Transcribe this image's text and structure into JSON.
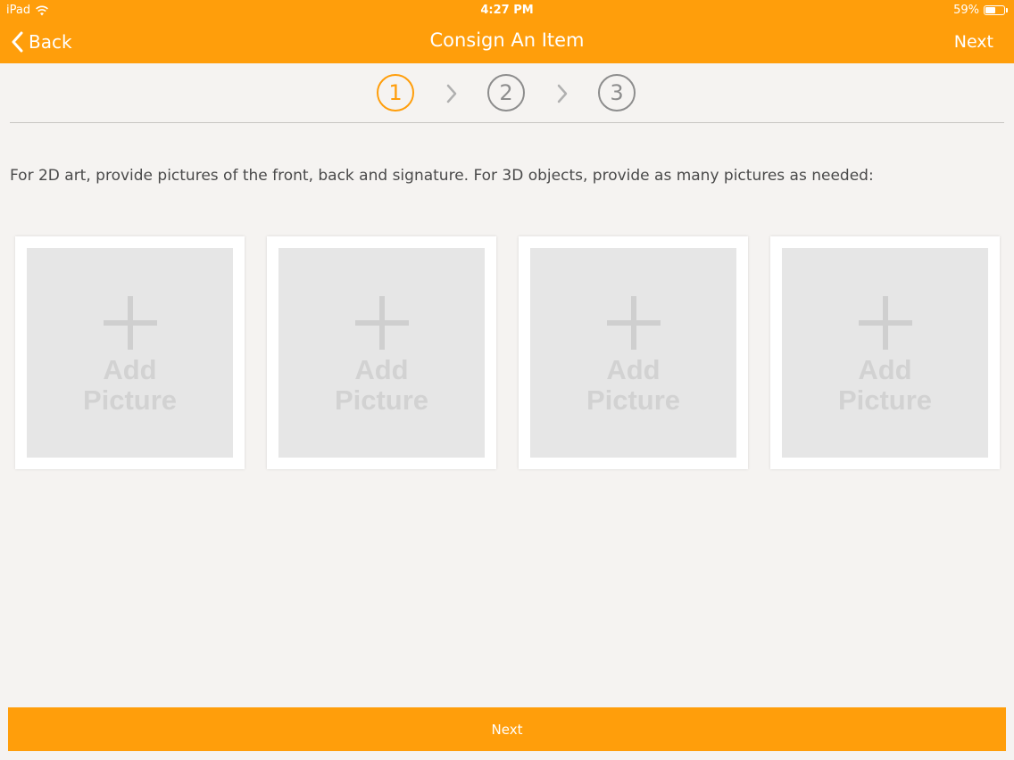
{
  "status_bar": {
    "device": "iPad",
    "time": "4:27 PM",
    "battery": "59%",
    "battery_level": 0.59,
    "wifi_icon": "wifi-icon",
    "battery_icon": "battery-icon"
  },
  "nav": {
    "back_label": "Back",
    "title": "Consign An Item",
    "next_label": "Next"
  },
  "steps": [
    {
      "label": "1",
      "active": true
    },
    {
      "label": "2",
      "active": false
    },
    {
      "label": "3",
      "active": false
    }
  ],
  "instructions": "For 2D art, provide pictures of the front, back and signature.  For 3D objects, provide as many pictures as needed:",
  "pictures": [
    {
      "line1": "Add",
      "line2": "Picture"
    },
    {
      "line1": "Add",
      "line2": "Picture"
    },
    {
      "line1": "Add",
      "line2": "Picture"
    },
    {
      "line1": "Add",
      "line2": "Picture"
    }
  ],
  "bottom_button": "Next",
  "colors": {
    "accent": "#ff9e0b",
    "background": "#f5f3f1",
    "step_inactive": "#8d8d8d"
  }
}
